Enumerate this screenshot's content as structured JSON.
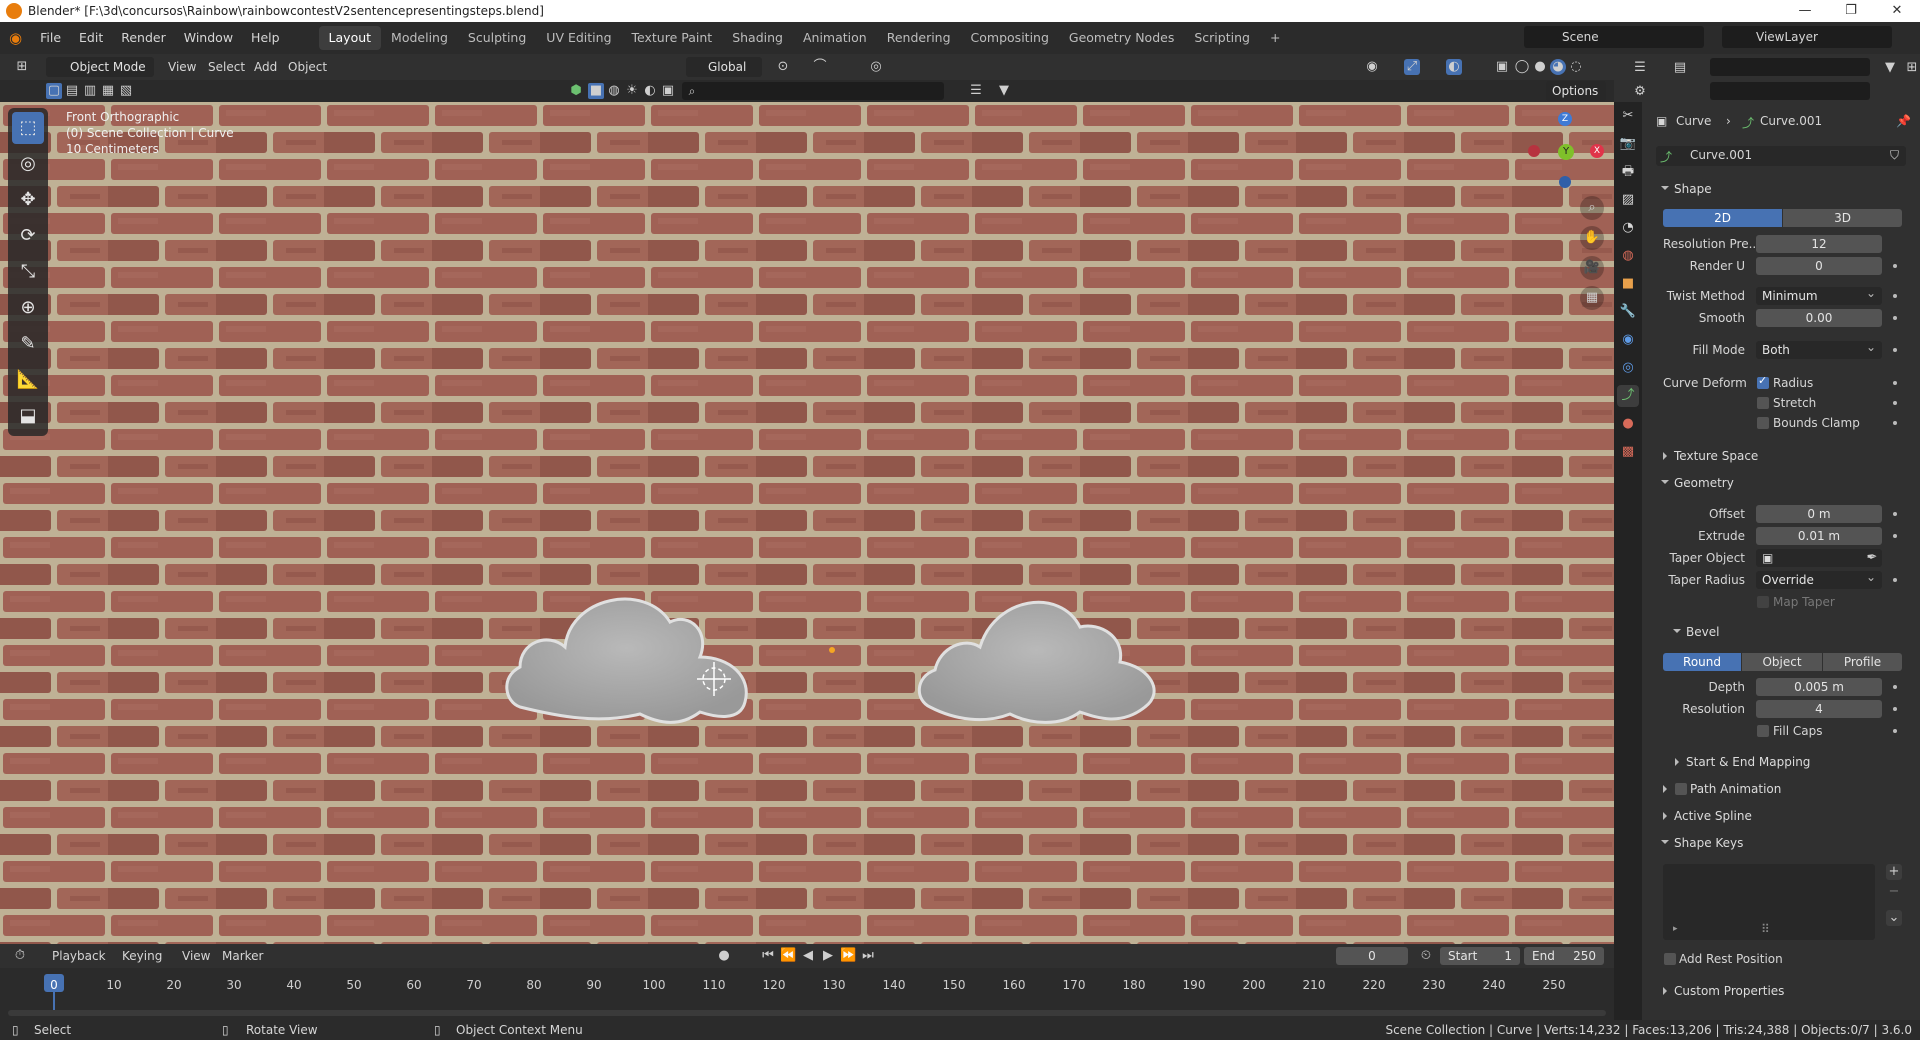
{
  "window": {
    "title": "Blender* [F:\\3d\\concursos\\Rainbow\\rainbowcontestV2sentencepresentingsteps.blend]",
    "minimize": "—",
    "maximize": "❐",
    "close": "✕"
  },
  "menu": [
    "File",
    "Edit",
    "Render",
    "Window",
    "Help"
  ],
  "workspaces": [
    "Layout",
    "Modeling",
    "Sculpting",
    "UV Editing",
    "Texture Paint",
    "Shading",
    "Animation",
    "Rendering",
    "Compositing",
    "Geometry Nodes",
    "Scripting"
  ],
  "workspace_add": "+",
  "scene": {
    "label": "Scene",
    "view_layer": "ViewLayer"
  },
  "viewport_header": {
    "mode": "Object Mode",
    "menus": [
      "View",
      "Select",
      "Add",
      "Object"
    ],
    "transform_orientation": "Global",
    "options": "Options"
  },
  "viewport_overlay": {
    "view_name": "Front Orthographic",
    "collection": "(0) Scene Collection | Curve",
    "scale": "10 Centimeters"
  },
  "gizmo": {
    "x": "X",
    "y": "Y",
    "z": "Z"
  },
  "properties": {
    "breadcrumb_object": "Curve",
    "breadcrumb_data": "Curve.001",
    "datablock_name": "Curve.001",
    "shape": {
      "header": "Shape",
      "mode_2d": "2D",
      "mode_3d": "3D",
      "resolution_preview_label": "Resolution Pre...",
      "resolution_preview": "12",
      "render_u_label": "Render U",
      "render_u": "0",
      "twist_method_label": "Twist Method",
      "twist_method": "Minimum",
      "smooth_label": "Smooth",
      "smooth": "0.00",
      "fill_mode_label": "Fill Mode",
      "fill_mode": "Both",
      "curve_deform_label": "Curve Deform",
      "radius_label": "Radius",
      "stretch_label": "Stretch",
      "bounds_clamp_label": "Bounds Clamp"
    },
    "texture_space": "Texture Space",
    "geometry": {
      "header": "Geometry",
      "offset_label": "Offset",
      "offset": "0 m",
      "extrude_label": "Extrude",
      "extrude": "0.01 m",
      "taper_object_label": "Taper Object",
      "taper_radius_label": "Taper Radius",
      "taper_radius": "Override",
      "map_taper_label": "Map Taper"
    },
    "bevel": {
      "header": "Bevel",
      "round": "Round",
      "object": "Object",
      "profile": "Profile",
      "depth_label": "Depth",
      "depth": "0.005 m",
      "resolution_label": "Resolution",
      "resolution": "4",
      "fill_caps_label": "Fill Caps"
    },
    "start_end_mapping": "Start & End Mapping",
    "path_animation": "Path Animation",
    "active_spline": "Active Spline",
    "shape_keys": "Shape Keys",
    "add_rest_position": "Add Rest Position",
    "custom_properties": "Custom Properties"
  },
  "timeline": {
    "menus": [
      "Playback",
      "Keying",
      "View",
      "Marker"
    ],
    "current_frame": "0",
    "start_label": "Start",
    "start": "1",
    "end_label": "End",
    "end": "250",
    "ticks": [
      "0",
      "10",
      "20",
      "30",
      "40",
      "50",
      "60",
      "70",
      "80",
      "90",
      "100",
      "110",
      "120",
      "130",
      "140",
      "150",
      "160",
      "170",
      "180",
      "190",
      "200",
      "210",
      "220",
      "230",
      "240",
      "250"
    ]
  },
  "statusbar": {
    "select": "Select",
    "rotate_view": "Rotate View",
    "context_menu": "Object Context Menu",
    "stats": "Scene Collection | Curve | Verts:14,232 | Faces:13,206 | Tris:24,388 | Objects:0/7 | 3.6.0"
  },
  "colors": {
    "accent": "#4772b3",
    "brick": "#9c6254",
    "mortar": "#c9c1a3",
    "cloud": "#a9a9a9"
  }
}
